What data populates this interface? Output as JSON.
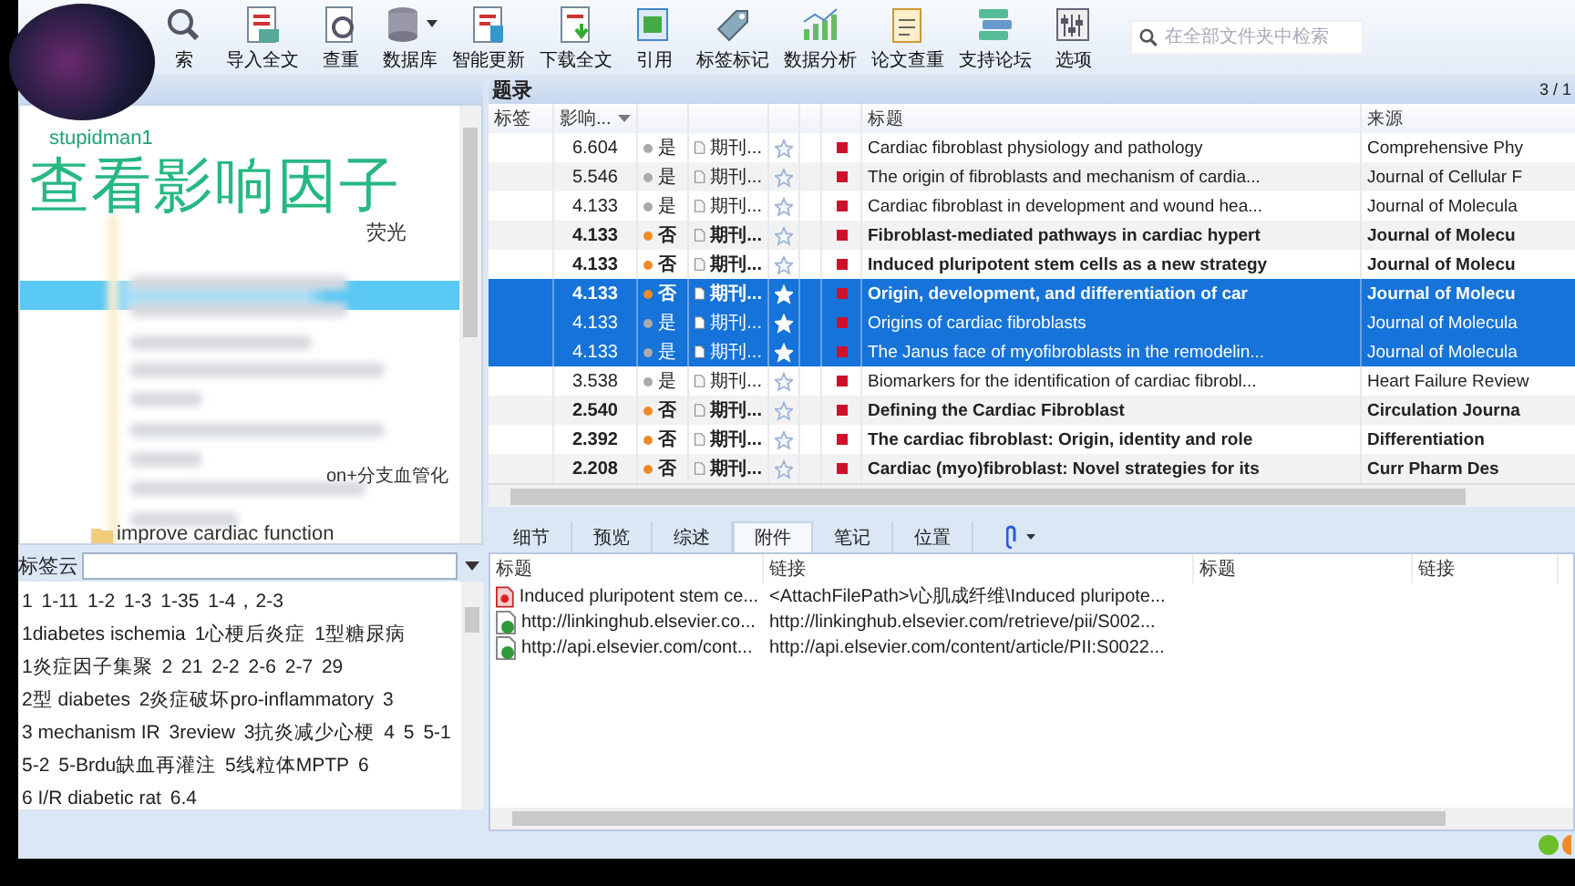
{
  "toolbar": {
    "items": [
      {
        "label": "索",
        "caret": false
      },
      {
        "label": "导入全文",
        "caret": false
      },
      {
        "label": "查重",
        "caret": false
      },
      {
        "label": "数据库",
        "caret": true
      },
      {
        "label": "智能更新",
        "caret": false
      },
      {
        "label": "下载全文",
        "caret": false
      },
      {
        "label": "引用",
        "caret": false
      },
      {
        "label": "标签标记",
        "caret": false
      },
      {
        "label": "数据分析",
        "caret": false
      },
      {
        "label": "论文查重",
        "caret": false
      },
      {
        "label": "支持论坛",
        "caret": false
      },
      {
        "label": "选项",
        "caret": false
      }
    ],
    "search": {
      "placeholder": "在全部文件夹中检索"
    }
  },
  "overlay": {
    "user": "stupidman1",
    "caption": "查看影响因子"
  },
  "tree": {
    "visible_texts": [
      "荧光",
      "on+分支血管化",
      "improve cardiac function"
    ]
  },
  "tag_cloud": {
    "label": "标签云",
    "tags": [
      "1",
      "1-11",
      "1-2",
      "1-3",
      "1-35",
      "1-4，2-3",
      "1diabetes ischemia",
      "1心梗后炎症",
      "1型糖尿病",
      "1炎症因子集聚",
      "2",
      "21",
      "2-2",
      "2-6",
      "2-7",
      "29",
      "2型 diabetes",
      "2炎症破坏pro-inflammatory",
      "3",
      "3 mechanism IR",
      "3review",
      "3抗炎减少心梗",
      "4",
      "5",
      "5-1",
      "5-2",
      "5-Brdu缺血再灌注",
      "5线粒体MPTP",
      "6",
      "6 I/R diabetic rat",
      "6.4"
    ]
  },
  "records": {
    "title": "题录",
    "page": "3 / 1",
    "columns": [
      "标签",
      "影响...",
      "",
      "",
      "",
      "",
      "",
      "标题",
      "来源"
    ],
    "rows": [
      {
        "impact": "6.604",
        "read": true,
        "read_label": "是",
        "type": "期刊...",
        "title": "Cardiac fibroblast physiology and pathology",
        "source": "Comprehensive Phy",
        "selected": false
      },
      {
        "impact": "5.546",
        "read": true,
        "read_label": "是",
        "type": "期刊...",
        "title": "The origin of fibroblasts and mechanism of cardia...",
        "source": "Journal of Cellular F",
        "selected": false
      },
      {
        "impact": "4.133",
        "read": true,
        "read_label": "是",
        "type": "期刊...",
        "title": "Cardiac fibroblast in development and wound hea...",
        "source": "Journal of Molecula",
        "selected": false
      },
      {
        "impact": "4.133",
        "read": false,
        "read_label": "否",
        "type": "期刊...",
        "title": "Fibroblast-mediated pathways in cardiac hypert",
        "source": "Journal of Molecu",
        "selected": false
      },
      {
        "impact": "4.133",
        "read": false,
        "read_label": "否",
        "type": "期刊...",
        "title": "Induced pluripotent stem cells as a new strategy",
        "source": "Journal of Molecu",
        "selected": false
      },
      {
        "impact": "4.133",
        "read": false,
        "read_label": "否",
        "type": "期刊...",
        "title": "Origin, development, and differentiation of car",
        "source": "Journal of Molecu",
        "selected": true
      },
      {
        "impact": "4.133",
        "read": true,
        "read_label": "是",
        "type": "期刊...",
        "title": "Origins of cardiac fibroblasts",
        "source": "Journal of Molecula",
        "selected": true
      },
      {
        "impact": "4.133",
        "read": true,
        "read_label": "是",
        "type": "期刊...",
        "title": "The Janus face of myofibroblasts in the remodelin...",
        "source": "Journal of Molecula",
        "selected": true
      },
      {
        "impact": "3.538",
        "read": true,
        "read_label": "是",
        "type": "期刊...",
        "title": "Biomarkers for the identification of cardiac fibrobl...",
        "source": "Heart Failure Review",
        "selected": false
      },
      {
        "impact": "2.540",
        "read": false,
        "read_label": "否",
        "type": "期刊...",
        "title": "Defining the Cardiac Fibroblast",
        "source": "Circulation Journa",
        "selected": false
      },
      {
        "impact": "2.392",
        "read": false,
        "read_label": "否",
        "type": "期刊...",
        "title": "The cardiac fibroblast: Origin, identity and role",
        "source": "Differentiation",
        "selected": false
      },
      {
        "impact": "2.208",
        "read": false,
        "read_label": "否",
        "type": "期刊...",
        "title": "Cardiac (myo)fibroblast: Novel strategies for its",
        "source": "Curr Pharm Des",
        "selected": false
      }
    ]
  },
  "detail_tabs": [
    {
      "label": "细节",
      "selected": false
    },
    {
      "label": "预览",
      "selected": false
    },
    {
      "label": "综述",
      "selected": false
    },
    {
      "label": "附件",
      "selected": true
    },
    {
      "label": "笔记",
      "selected": false
    },
    {
      "label": "位置",
      "selected": false
    }
  ],
  "attachments": {
    "columns": [
      "标题",
      "链接",
      "标题",
      "链接"
    ],
    "rows": [
      {
        "kind": "pdf",
        "title": "Induced pluripotent stem ce...",
        "link": "<AttachFilePath>\\心肌成纤维\\Induced pluripote..."
      },
      {
        "kind": "web",
        "title": "http://linkinghub.elsevier.co...",
        "link": "http://linkinghub.elsevier.com/retrieve/pii/S002..."
      },
      {
        "kind": "web",
        "title": "http://api.elsevier.com/cont...",
        "link": "http://api.elsevier.com/content/article/PII:S0022..."
      }
    ]
  }
}
